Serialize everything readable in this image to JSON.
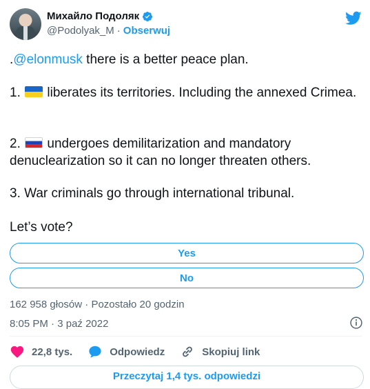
{
  "author": {
    "name": "Михайло Подоляк",
    "handle": "@Podolyak_M",
    "separator": "·",
    "follow_label": "Obserwuj"
  },
  "tweet": {
    "line1_prefix": ".",
    "line1_mention": "@elonmusk",
    "line1_rest": " there is a better peace plan.",
    "point1_num": "1. ",
    "point1_text": " liberates its territories. Including the annexed Crimea.",
    "point2_num": "2. ",
    "point2_text": " undergoes demilitarization and mandatory denuclearization so it can no longer threaten others.",
    "point3": "3. War criminals go through international tribunal.",
    "closing": "Let’s vote?"
  },
  "poll": {
    "options": [
      "Yes",
      "No"
    ],
    "votes_text": "162 958 głosów",
    "separator": "·",
    "remaining_text": "Pozostało 20 godzin"
  },
  "timestamp": {
    "time": "8:05 PM",
    "separator": "·",
    "date": "3 paź 2022"
  },
  "actions": {
    "like_count": "22,8 tys.",
    "reply_label": "Odpowiedz",
    "copy_link_label": "Skopiuj link"
  },
  "more": {
    "label": "Przeczytaj 1,4 tys. odpowiedzi"
  },
  "colors": {
    "accent": "#1d9bf0",
    "like": "#f91880",
    "text": "#0f1419",
    "secondary": "#536471"
  },
  "icons": {
    "verified": "verified-badge-icon",
    "brand": "twitter-bird-icon",
    "info": "info-icon",
    "like": "heart-icon",
    "reply": "reply-bubble-icon",
    "copy": "link-icon",
    "flag1": "ukraine-flag-icon",
    "flag2": "russia-flag-icon"
  }
}
